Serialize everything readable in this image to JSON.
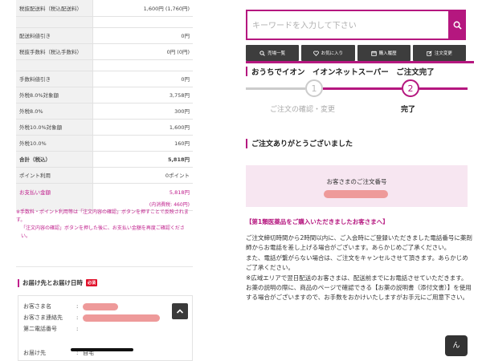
{
  "left_panel": {
    "rows": [
      {
        "label": "税抜配送料（税込配送料）",
        "value": "1,600円 (1,760円)"
      },
      {
        "label": "配送料値引き",
        "value": "0円"
      },
      {
        "label": "税抜手数料（税込手数料）",
        "value": "0円 (0円)"
      },
      {
        "label": "手数料値引き",
        "value": "0円"
      },
      {
        "label": "外税8.0%対象額",
        "value": "3,758円"
      },
      {
        "label": "外税8.0%",
        "value": "300円"
      },
      {
        "label": "外税10.0%対象額",
        "value": "1,600円"
      },
      {
        "label": "外税10.0%",
        "value": "160円"
      },
      {
        "label": "合計（税込）",
        "value": "5,818円"
      },
      {
        "label": "ポイント利用",
        "value": "0ポイント"
      },
      {
        "label": "お支払い金額",
        "value": "5,818円",
        "sub": "(内消費税: 460円)"
      }
    ],
    "note_lines": [
      "※手数料・ポイント利用等は「注文内容の確認」ボタンを押すことで反映されます。",
      "「注文内容の確認」ボタンを押した後に、お支払い金額を再度ご確認ください。"
    ],
    "shipping_title": "お届け先とお届け日時",
    "required_badge": "必須",
    "shipping_labels": {
      "name": "お客さま名",
      "contact": "お客さま連絡先",
      "second_phone": "第二電話番号",
      "destination": "お届け先"
    },
    "colon": ":",
    "destination_value": "自宅",
    "scroll_top_icon": "chevron-up-icon"
  },
  "right_panel": {
    "search_placeholder": "キーワードを入力して下さい",
    "tabs": [
      {
        "label": "売場一覧",
        "icon": "search-icon"
      },
      {
        "label": "お気に入り",
        "icon": "heart-icon"
      },
      {
        "label": "購入履歴",
        "icon": "calendar-icon"
      },
      {
        "label": "注文変更",
        "icon": "edit-icon"
      }
    ],
    "store_title": "おうちでイオン　イオンネットスーパー　ご注文完了",
    "steps": [
      {
        "number": "1",
        "label": "ご注文の確認・変更"
      },
      {
        "number": "2",
        "label": "完了"
      }
    ],
    "thanks_heading": "ご注文ありがとうございました",
    "order_number_label": "お客さまのご注文番号",
    "rx_title": "【第1類医薬品をご購入いただきましたお客さまへ】",
    "rx_paragraphs": [
      "ご注文締切時間から2時間以内に、ご入会時にご登録いただきました電話番号に薬剤師からお電話を差し上げる場合がございます。あらかじめご了承ください。",
      "また、電話が繋がらない場合は、ご注文をキャンセルさせて頂きます。あらかじめご了承ください。",
      "※広域エリアで翌日配送のお客さまは、配送前までにお電話させていただきます。",
      "お薬の説明の際に、商品のページで確認できる【お薬の説明書（添付文書）】を使用する場合がございますので、お手数をおかけいたしますがお手元にご用意下さい。"
    ],
    "brand_icon_text": "ん"
  },
  "colors": {
    "accent": "#b5177f",
    "tab_bg": "#3d3d3d",
    "order_box_bg": "#f7e6f1",
    "redacted": "#ee9a9a"
  }
}
